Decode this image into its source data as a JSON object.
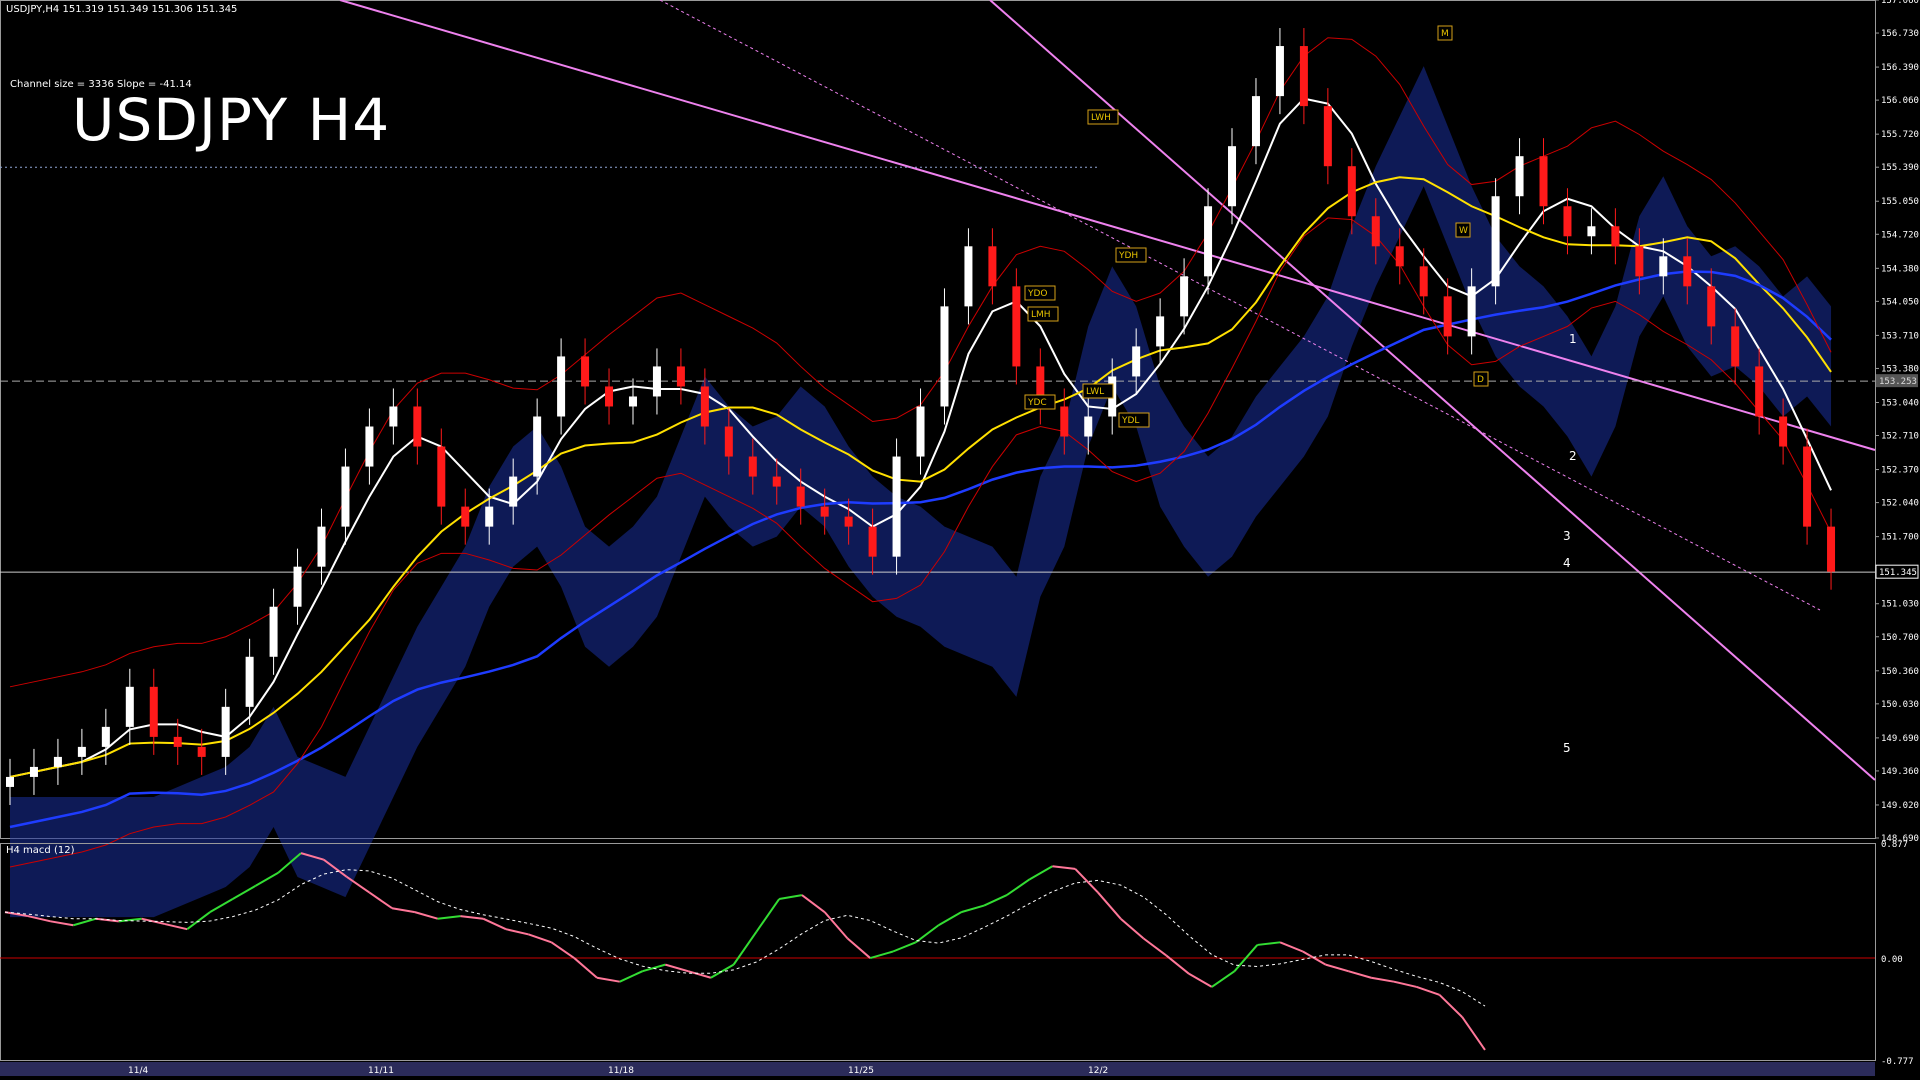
{
  "window": {
    "symbol_info": "USDJPY,H4  151.319 151.349 151.306 151.345",
    "channel_info": "Channel size = 3336 Slope = -41.14",
    "big_title": "USDJPY H4",
    "macd_label": "H4  macd (12)"
  },
  "colors": {
    "background": "#000000",
    "bull_candle": "#ffffff",
    "bear_candle": "#ff1a1a",
    "channel": "#ee82ee",
    "ma_fast": "#ffffff",
    "ma_slow": "#ffe000",
    "ma_long": "#1e3cff",
    "bollinger": "#cc0000",
    "green_line": "#00b800",
    "cloud": "#1a2f9c",
    "macd_up": "#33dd33",
    "macd_down": "#ff7799",
    "macd_signal": "#ffffff",
    "zero_line": "#cc0000"
  },
  "chart_data": [
    {
      "type": "candlestick",
      "panel": "price",
      "ylim": [
        148.69,
        157.06
      ],
      "y_ticks": [
        157.06,
        156.73,
        156.39,
        156.06,
        155.72,
        155.39,
        155.05,
        154.72,
        154.38,
        154.05,
        153.71,
        153.38,
        153.04,
        152.71,
        152.37,
        152.04,
        151.7,
        151.03,
        150.7,
        150.36,
        150.03,
        149.69,
        149.36,
        149.02,
        148.69
      ],
      "y_tick_labels": [
        "157.060",
        "156.730",
        "156.390",
        "156.060",
        "155.720",
        "155.390",
        "155.050",
        "154.720",
        "154.380",
        "154.050",
        "153.710",
        "153.380",
        "153.040",
        "152.710",
        "152.370",
        "152.040",
        "151.700",
        "151.030",
        "150.700",
        "150.360",
        "150.030",
        "149.690",
        "149.360",
        "149.020",
        "148.690"
      ],
      "current_price": 151.345,
      "current_price_label": "151.345",
      "ask_price_label": "153.253",
      "x_labels": [
        "11/4",
        "11/11",
        "11/18",
        "11/25",
        "12/2"
      ],
      "close_path": [
        149.3,
        149.4,
        149.5,
        149.6,
        149.8,
        150.2,
        149.7,
        149.6,
        149.5,
        150.0,
        150.5,
        151.0,
        151.4,
        151.8,
        152.4,
        152.8,
        153.0,
        152.6,
        152.0,
        151.8,
        152.0,
        152.3,
        152.9,
        153.5,
        153.2,
        153.0,
        153.1,
        153.4,
        153.2,
        152.8,
        152.5,
        152.3,
        152.2,
        152.0,
        151.9,
        151.8,
        151.5,
        152.5,
        153.0,
        154.0,
        154.6,
        154.2,
        153.4,
        153.0,
        152.7,
        152.9,
        153.3,
        153.6,
        153.9,
        154.3,
        155.0,
        155.6,
        156.1,
        156.6,
        156.0,
        155.4,
        154.9,
        154.6,
        154.4,
        154.1,
        153.7,
        154.2,
        155.1,
        155.5,
        155.0,
        154.7,
        154.8,
        154.6,
        154.3,
        154.5,
        154.2,
        153.8,
        153.4,
        152.9,
        152.6,
        151.8,
        151.35
      ],
      "annotations": [
        "LWH",
        "YDH",
        "YDO",
        "LMH",
        "LWL",
        "YDC",
        "YDL",
        "M",
        "W",
        "D",
        "1",
        "2",
        "3",
        "4",
        "5"
      ]
    },
    {
      "type": "line",
      "panel": "macd",
      "ylim": [
        -0.777,
        0.877
      ],
      "y_tick_labels": [
        "0.877",
        "0.00",
        "-0.777"
      ],
      "series": [
        {
          "values": [
            0.35,
            0.32,
            0.28,
            0.25,
            0.3,
            0.28,
            0.3,
            0.26,
            0.22,
            0.35,
            0.45,
            0.55,
            0.65,
            0.8,
            0.75,
            0.62,
            0.5,
            0.38,
            0.35,
            0.3,
            0.32,
            0.3,
            0.22,
            0.18,
            0.12,
            0.0,
            -0.15,
            -0.18,
            -0.1,
            -0.05,
            -0.1,
            -0.15,
            -0.05,
            0.2,
            0.45,
            0.48,
            0.35,
            0.15,
            0.0,
            0.05,
            0.12,
            0.25,
            0.35,
            0.4,
            0.48,
            0.6,
            0.7,
            0.68,
            0.5,
            0.3,
            0.15,
            0.02,
            -0.12,
            -0.22,
            -0.1,
            0.1,
            0.12,
            0.05,
            -0.05,
            -0.1,
            -0.15,
            -0.18,
            -0.22,
            -0.28,
            -0.45,
            -0.7
          ]
        }
      ]
    }
  ]
}
